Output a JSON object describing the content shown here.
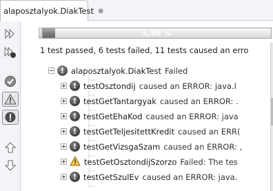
{
  "tab": {
    "title": "alaposztalyok.DiakTest",
    "close_glyph": "⊗"
  },
  "progress": {
    "text": "5,56 %",
    "fraction": 0.0556
  },
  "summary": "1 test passed, 6 tests failed, 11 tests caused an erro",
  "root": {
    "label": "alaposztalyok.DiakTest",
    "status": "Failed"
  },
  "tests": [
    {
      "label": "testOsztondij",
      "status": "caused an ERROR: java.l",
      "icon": "error-icon"
    },
    {
      "label": "testGetTantargyak",
      "status": "caused an ERROR: .",
      "icon": "error-icon"
    },
    {
      "label": "testGetEhaKod",
      "status": "caused an ERROR: java",
      "icon": "error-icon"
    },
    {
      "label": "testGetTeljesitettKredit",
      "status": "caused an ERR(",
      "icon": "error-icon"
    },
    {
      "label": "testGetVizsgaSzam",
      "status": "caused an ERROR: ,",
      "icon": "error-icon"
    },
    {
      "label": "testGetOsztondijSzorzo",
      "status": "Failed: The tes",
      "icon": "warning-icon"
    },
    {
      "label": "testGetSzulEv",
      "status": "caused an ERROR: java.",
      "icon": "error-icon"
    }
  ],
  "colors": {
    "accent_gray": "#7a7a7a",
    "warning_yellow": "#f2c94c"
  }
}
